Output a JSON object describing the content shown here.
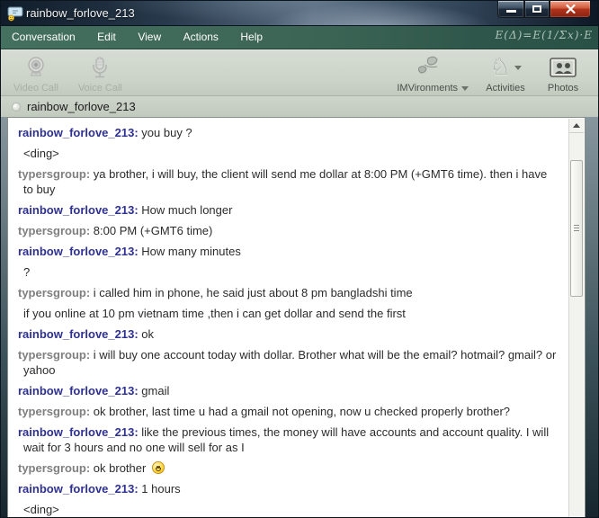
{
  "window": {
    "title": "rainbow_forlove_213",
    "controls": {
      "minimize": "minimize",
      "maximize": "maximize",
      "close": "close"
    }
  },
  "menu": {
    "items": [
      "Conversation",
      "Edit",
      "View",
      "Actions",
      "Help"
    ],
    "chalk_formula": "E(Δ)=E(1/Σx)·E"
  },
  "toolbar": {
    "video_call": "Video Call",
    "voice_call": "Voice Call",
    "imvironments": "IMVironments",
    "activities": "Activities",
    "photos": "Photos"
  },
  "status": {
    "username": "rainbow_forlove_213"
  },
  "colors": {
    "rainbow_name": "#2e3192",
    "typers_name": "#7f7f7f",
    "menu_bg": "#3c6455",
    "close_button": "#b1341c",
    "chat_bg": "#ffffff"
  },
  "chat": {
    "messages": [
      {
        "sender": "rainbow_forlove_213",
        "text": "you buy ?"
      },
      {
        "sender": null,
        "text": "<ding>"
      },
      {
        "sender": "typersgroup",
        "text": "ya brother, i will buy, the client will send me dollar at 8:00 PM (+GMT6 time). then i have to buy"
      },
      {
        "sender": "rainbow_forlove_213",
        "text": "How much longer"
      },
      {
        "sender": "typersgroup",
        "text": "8:00 PM (+GMT6 time)"
      },
      {
        "sender": "rainbow_forlove_213",
        "text": "How many minutes"
      },
      {
        "sender": null,
        "text": "?"
      },
      {
        "sender": "typersgroup",
        "text": "i called him in phone, he said just about 8 pm bangladshi time"
      },
      {
        "sender": null,
        "text": "if you online at 10 pm vietnam time ,then i can get dollar and send the first"
      },
      {
        "sender": "rainbow_forlove_213",
        "text": "ok"
      },
      {
        "sender": "typersgroup",
        "text": "i will buy one account today with dollar. Brother what will be the email? hotmail? gmail? or yahoo"
      },
      {
        "sender": "rainbow_forlove_213",
        "text": "gmail"
      },
      {
        "sender": "typersgroup",
        "text": "ok brother, last time u had a gmail not opening, now u checked properly brother?"
      },
      {
        "sender": "rainbow_forlove_213",
        "text": "like the previous times, the money will have accounts and account quality. I will wait for 3 hours and no one will sell for as I"
      },
      {
        "sender": "typersgroup",
        "text": "ok brother",
        "emoticon": "smiley"
      },
      {
        "sender": "rainbow_forlove_213",
        "text": "1 hours"
      },
      {
        "sender": null,
        "text": "<ding>"
      }
    ]
  }
}
